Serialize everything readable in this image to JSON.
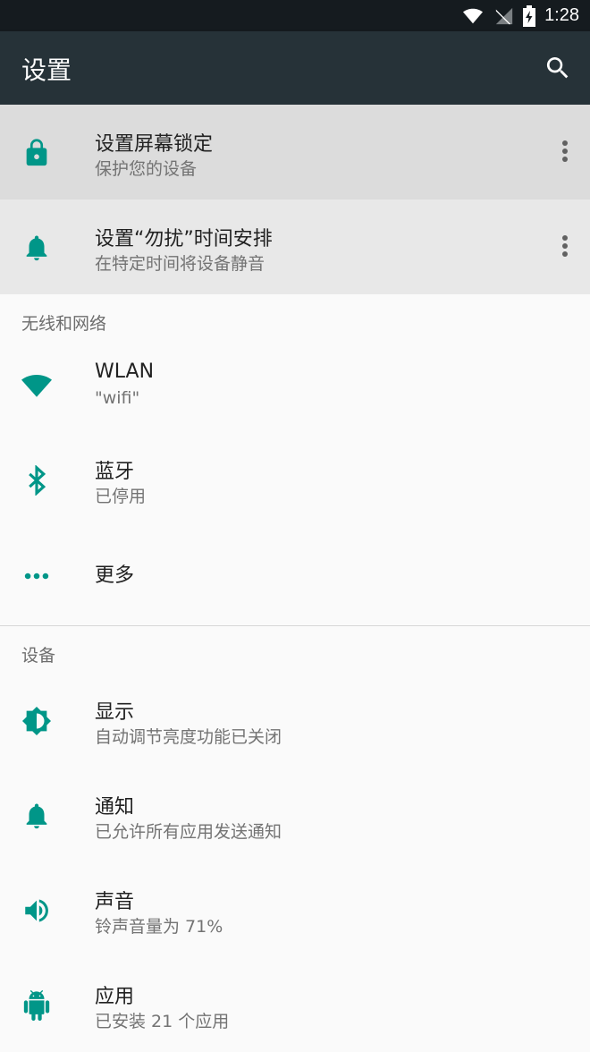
{
  "status_bar": {
    "time": "1:28"
  },
  "app_bar": {
    "title": "设置"
  },
  "suggestions": [
    {
      "title": "设置屏幕锁定",
      "subtitle": "保护您的设备",
      "icon": "lock-icon"
    },
    {
      "title": "设置“勿扰”时间安排",
      "subtitle": "在特定时间将设备静音",
      "icon": "bell-icon"
    }
  ],
  "sections": [
    {
      "header": "无线和网络",
      "items": [
        {
          "title": "WLAN",
          "subtitle": "\"wifi\"",
          "icon": "wifi-icon"
        },
        {
          "title": "蓝牙",
          "subtitle": "已停用",
          "icon": "bluetooth-icon"
        },
        {
          "title": "更多",
          "icon": "more-horiz-icon"
        }
      ]
    },
    {
      "header": "设备",
      "items": [
        {
          "title": "显示",
          "subtitle": "自动调节亮度功能已关闭",
          "icon": "brightness-icon"
        },
        {
          "title": "通知",
          "subtitle": "已允许所有应用发送通知",
          "icon": "bell-icon"
        },
        {
          "title": "声音",
          "subtitle": "铃声音量为 71%",
          "icon": "volume-icon"
        },
        {
          "title": "应用",
          "subtitle": "已安装 21 个应用",
          "icon": "android-icon"
        }
      ]
    }
  ],
  "colors": {
    "accent": "#009688",
    "app_bar": "#263238",
    "status_bar": "#151b1f"
  }
}
